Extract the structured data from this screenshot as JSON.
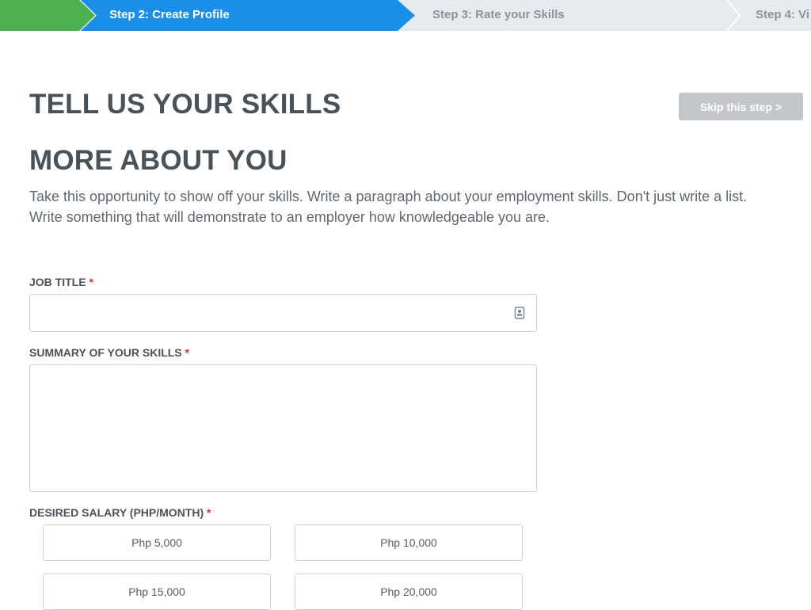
{
  "steps": {
    "active_label": "Step 2: Create Profile",
    "step3_label": "Step 3: Rate your Skills",
    "step4_label": "Step 4: Vi"
  },
  "header": {
    "title": "TELL US YOUR SKILLS",
    "subtitle": "MORE ABOUT YOU",
    "skip_label": "Skip this step >",
    "intro": "Take this opportunity to show off your skills. Write a paragraph about your employment skills. Don't just write a list. Write something that will demonstrate to an employer how knowledgeable you are."
  },
  "form": {
    "job_title_label": "JOB TITLE",
    "summary_label": "SUMMARY OF YOUR SKILLS",
    "salary_label": "DESIRED SALARY (PHP/MONTH)",
    "required_marker": "*",
    "job_title_value": "",
    "summary_value": "",
    "salary_options": [
      "Php 5,000",
      "Php 10,000",
      "Php 15,000",
      "Php 20,000"
    ]
  },
  "colors": {
    "done_step": "#4caf50",
    "active_step": "#1b8fe8",
    "required": "#d0392f",
    "skip_button": "#c4c7ca"
  }
}
